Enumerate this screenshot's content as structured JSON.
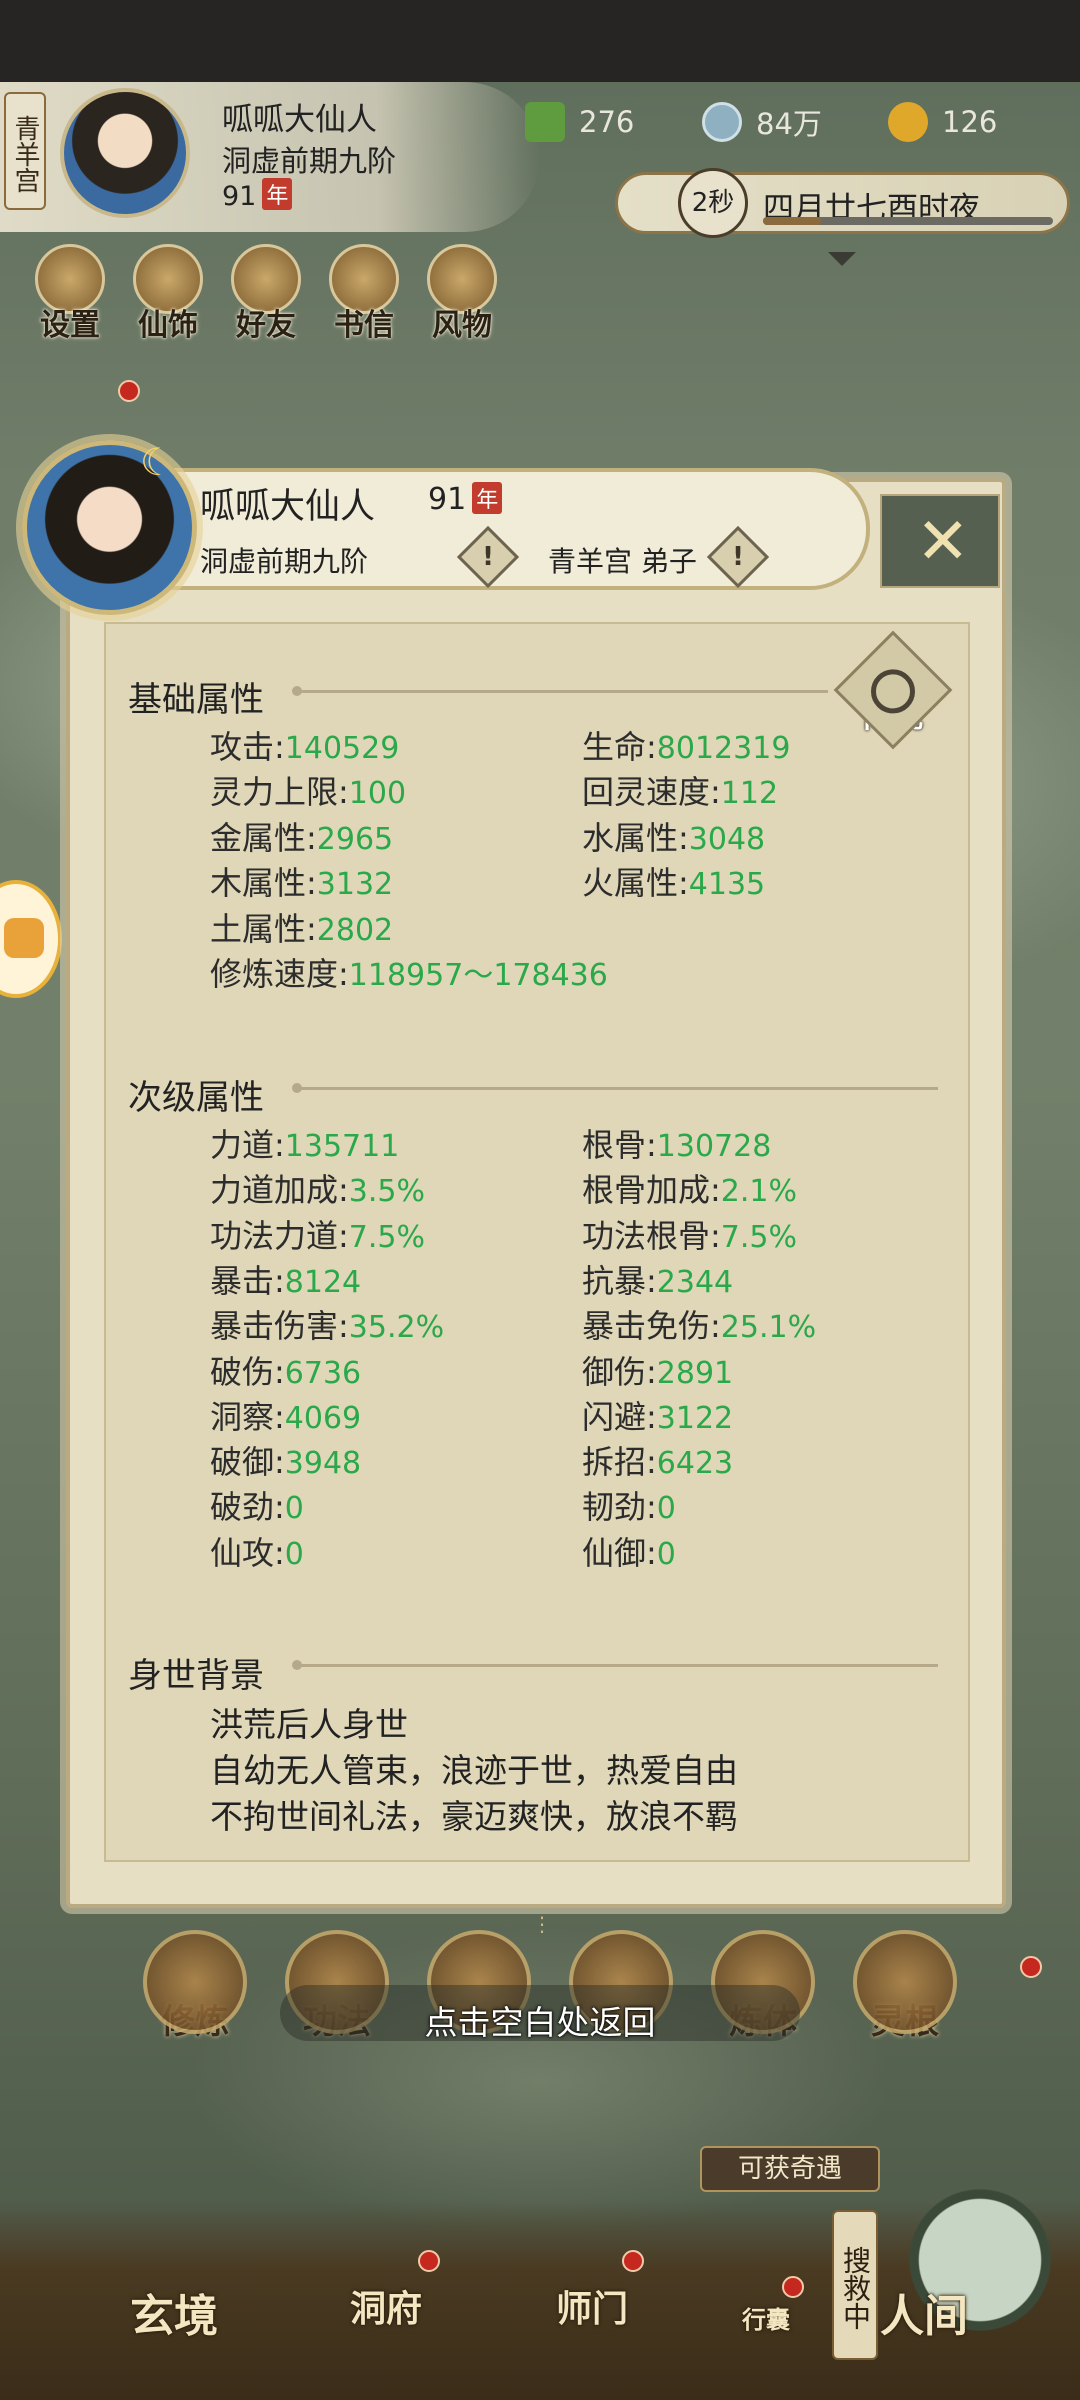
{
  "header": {
    "sect_tag": "青羊宫",
    "player_name": "呱呱大仙人",
    "realm": "洞虚前期九阶",
    "level": "91",
    "level_unit": "年",
    "resources": [
      {
        "icon": "spirit-leaf-icon",
        "value": "276"
      },
      {
        "icon": "coin-icon",
        "value": "84万"
      },
      {
        "icon": "strength-icon",
        "value": "126"
      }
    ],
    "time": {
      "seconds_label": "2秒",
      "date": "四月廿七酉时夜",
      "progress": 0.2
    },
    "top_icons": [
      "设置",
      "仙饰",
      "好友",
      "书信",
      "风物"
    ]
  },
  "dialog": {
    "name": "呱呱大仙人",
    "level": "91",
    "level_unit": "年",
    "realm": "洞虚前期九阶",
    "sect_role": "青羊宫 弟子",
    "warn_symbol": "!",
    "close_symbol": "✕",
    "inner_view_label": "内视",
    "basic": {
      "title": "基础属性",
      "stats": [
        {
          "label": "攻击:",
          "value": "140529"
        },
        {
          "label": "生命:",
          "value": "8012319"
        },
        {
          "label": "灵力上限:",
          "value": "100"
        },
        {
          "label": "回灵速度:",
          "value": "112"
        },
        {
          "label": "金属性:",
          "value": "2965"
        },
        {
          "label": "水属性:",
          "value": "3048"
        },
        {
          "label": "木属性:",
          "value": "3132"
        },
        {
          "label": "火属性:",
          "value": "4135"
        },
        {
          "label": "土属性:",
          "value": "2802"
        },
        {
          "label": "修炼速度:",
          "value": "118957～178436"
        }
      ]
    },
    "secondary": {
      "title": "次级属性",
      "stats": [
        {
          "label": "力道:",
          "value": "135711"
        },
        {
          "label": "根骨:",
          "value": "130728"
        },
        {
          "label": "力道加成:",
          "value": "3.5%"
        },
        {
          "label": "根骨加成:",
          "value": "2.1%"
        },
        {
          "label": "功法力道:",
          "value": "7.5%"
        },
        {
          "label": "功法根骨:",
          "value": "7.5%"
        },
        {
          "label": "暴击:",
          "value": "8124"
        },
        {
          "label": "抗暴:",
          "value": "2344"
        },
        {
          "label": "暴击伤害:",
          "value": "35.2%"
        },
        {
          "label": "暴击免伤:",
          "value": "25.1%"
        },
        {
          "label": "破伤:",
          "value": "6736"
        },
        {
          "label": "御伤:",
          "value": "2891"
        },
        {
          "label": "洞察:",
          "value": "4069"
        },
        {
          "label": "闪避:",
          "value": "3122"
        },
        {
          "label": "破御:",
          "value": "3948"
        },
        {
          "label": "拆招:",
          "value": "6423"
        },
        {
          "label": "破劲:",
          "value": "0"
        },
        {
          "label": "韧劲:",
          "value": "0"
        },
        {
          "label": "仙攻:",
          "value": "0"
        },
        {
          "label": "仙御:",
          "value": "0"
        }
      ]
    },
    "background": {
      "title": "身世背景",
      "lines": [
        "洪荒后人身世",
        "自幼无人管束，浪迹于世，热爱自由",
        "不拘世间礼法，豪迈爽快，放浪不羁"
      ]
    }
  },
  "skills": [
    "修炼",
    "功法",
    "",
    "",
    "炼体",
    "灵根"
  ],
  "hint": "点击空白处返回",
  "opportunity": "可获奇遇",
  "search_tag": "搜救中",
  "bottom_nav": [
    "玄境",
    "洞府",
    "师门",
    "行囊",
    "人间"
  ],
  "colors": {
    "stat_value": "#2aa84a",
    "red_dot": "#c5281e",
    "panel": "#dfd7b8"
  }
}
